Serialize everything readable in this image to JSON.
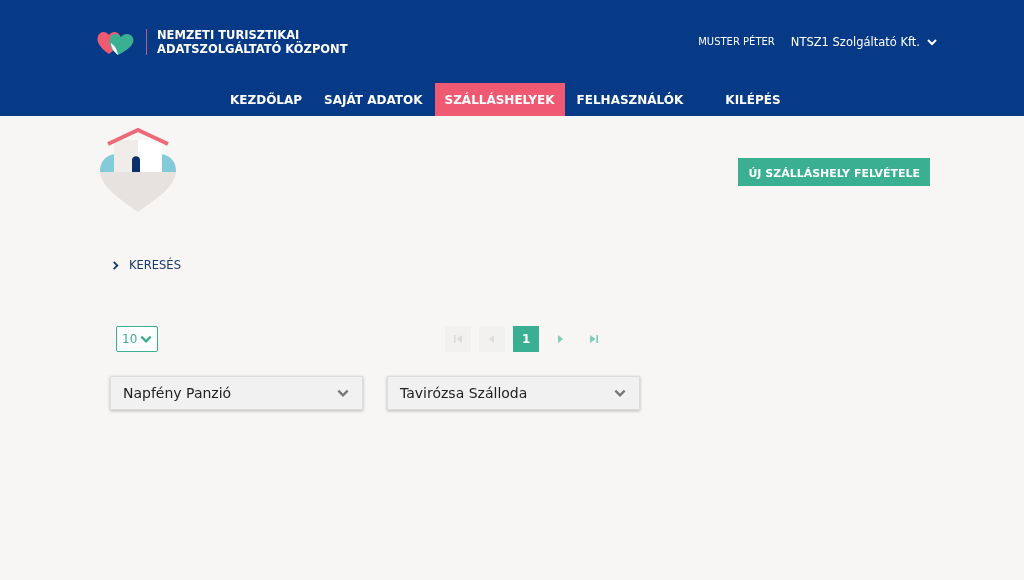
{
  "header": {
    "brand_line_1": "NEMZETI TURISZTIKAI",
    "brand_line_2": "ADATSZOLGÁLTATÓ KÖZPONT",
    "user_name": "MUSTER PÉTER",
    "organization": "NTSZ1 Szolgáltató Kft."
  },
  "nav": [
    {
      "label": "KEZDŐLAP",
      "selected": false
    },
    {
      "label": "SAJÁT ADATOK",
      "selected": false
    },
    {
      "label": "SZÁLLÁSHELYEK",
      "selected": true
    },
    {
      "label": "FELHASZNÁLÓK",
      "selected": false
    },
    {
      "label": "KILÉPÉS",
      "selected": false
    }
  ],
  "add_button": "ÚJ SZÁLLÁSHELY FELVÉTELE",
  "search_toggle": {
    "label": "KERESÉS",
    "expanded": false
  },
  "page_size": "10",
  "pagination": [
    {
      "kind": "first",
      "disabled": true
    },
    {
      "kind": "prev",
      "disabled": true
    },
    {
      "kind": "page",
      "label": "1",
      "selected": true
    },
    {
      "kind": "next",
      "disabled": false
    },
    {
      "kind": "last",
      "disabled": false
    }
  ],
  "accommodations": [
    {
      "name": "Napfény Panzió",
      "expanded": false
    },
    {
      "name": "Tavirózsa Szálloda",
      "expanded": false
    }
  ]
}
